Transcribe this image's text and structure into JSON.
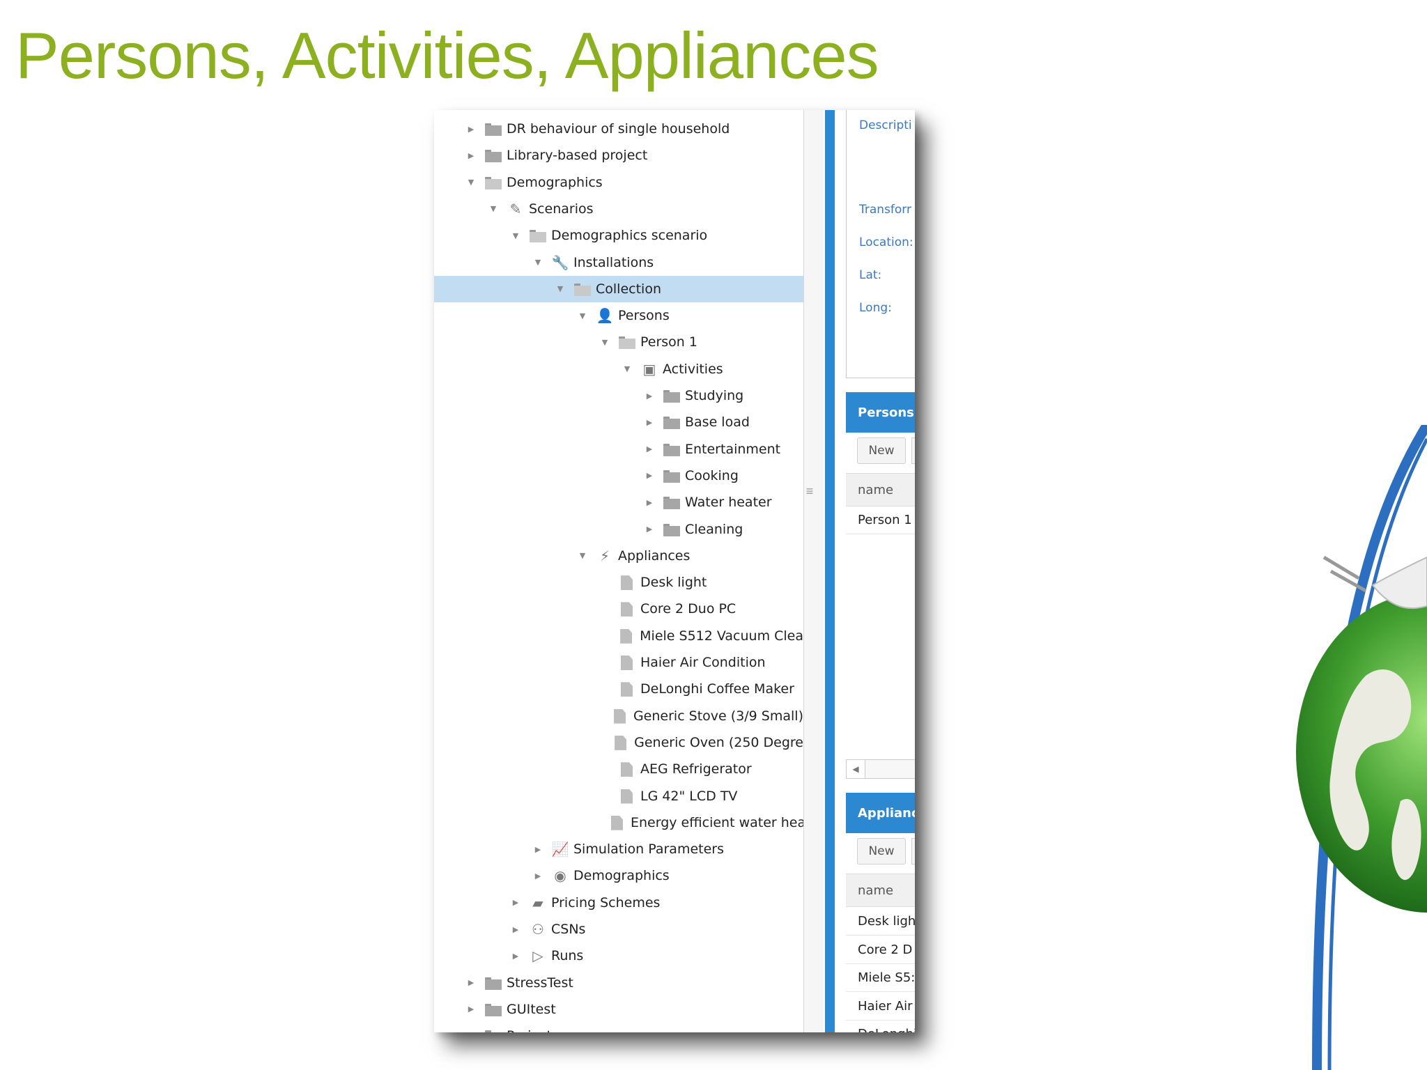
{
  "slide": {
    "title": "Persons, Activities, Appliances"
  },
  "tree": {
    "rows": [
      {
        "label": "DR behaviour of single household",
        "caret": "▶",
        "icon": "folder"
      },
      {
        "label": "Library-based project",
        "caret": "▶",
        "icon": "folder"
      },
      {
        "label": "Demographics",
        "caret": "▼",
        "icon": "folder-open"
      },
      {
        "label": "Scenarios",
        "caret": "▼",
        "icon": "pencil-icon"
      },
      {
        "label": "Demographics scenario",
        "caret": "▼",
        "icon": "folder-open"
      },
      {
        "label": "Installations",
        "caret": "▼",
        "icon": "wrench-icon"
      },
      {
        "label": "Collection",
        "caret": "▼",
        "icon": "folder-open"
      },
      {
        "label": "Persons",
        "caret": "▼",
        "icon": "person-icon"
      },
      {
        "label": "Person 1",
        "caret": "▼",
        "icon": "folder-open"
      },
      {
        "label": "Activities",
        "caret": "▼",
        "icon": "activities-icon"
      },
      {
        "label": "Studying",
        "caret": "▶",
        "icon": "folder"
      },
      {
        "label": "Base load",
        "caret": "▶",
        "icon": "folder"
      },
      {
        "label": "Entertainment",
        "caret": "▶",
        "icon": "folder"
      },
      {
        "label": "Cooking",
        "caret": "▶",
        "icon": "folder"
      },
      {
        "label": "Water heater",
        "caret": "▶",
        "icon": "folder"
      },
      {
        "label": "Cleaning",
        "caret": "▶",
        "icon": "folder"
      },
      {
        "label": "Appliances",
        "caret": "▼",
        "icon": "plug-icon"
      },
      {
        "label": "Desk light",
        "caret": "",
        "icon": "doc"
      },
      {
        "label": "Core 2 Duo PC",
        "caret": "",
        "icon": "doc"
      },
      {
        "label": "Miele S512 Vacuum Clea",
        "caret": "",
        "icon": "doc"
      },
      {
        "label": "Haier Air Condition",
        "caret": "",
        "icon": "doc"
      },
      {
        "label": "DeLonghi Coffee Maker",
        "caret": "",
        "icon": "doc"
      },
      {
        "label": "Generic Stove (3/9 Small)",
        "caret": "",
        "icon": "doc"
      },
      {
        "label": "Generic Oven (250 Degre",
        "caret": "",
        "icon": "doc"
      },
      {
        "label": "AEG Refrigerator",
        "caret": "",
        "icon": "doc"
      },
      {
        "label": "LG 42\" LCD TV",
        "caret": "",
        "icon": "doc"
      },
      {
        "label": "Energy efficient water hea",
        "caret": "",
        "icon": "doc"
      },
      {
        "label": "Simulation Parameters",
        "caret": "▶",
        "icon": "chart-icon"
      },
      {
        "label": "Demographics",
        "caret": "▶",
        "icon": "globe-icon"
      },
      {
        "label": "Pricing Schemes",
        "caret": "▶",
        "icon": "money-icon"
      },
      {
        "label": "CSNs",
        "caret": "▶",
        "icon": "network-icon"
      },
      {
        "label": "Runs",
        "caret": "▶",
        "icon": "play-icon"
      },
      {
        "label": "StressTest",
        "caret": "▶",
        "icon": "folder"
      },
      {
        "label": "GUItest",
        "caret": "▶",
        "icon": "folder"
      },
      {
        "label": "Project",
        "caret": "▶",
        "icon": "folder"
      }
    ]
  },
  "details": {
    "description_label": "Descripti",
    "transform_label": "Transforr",
    "location_label": "Location:",
    "lat_label": "Lat:",
    "long_label": "Long:"
  },
  "persons_panel": {
    "title": "Persons",
    "new_label": "New",
    "column": "name",
    "rows": [
      "Person 1"
    ]
  },
  "appliances_panel": {
    "title": "Applianc",
    "new_label": "New",
    "column": "name",
    "rows": [
      "Desk ligh",
      "Core 2 D",
      "Miele S5:",
      "Haier Air",
      "DeLonghi"
    ]
  },
  "colors": {
    "title_green": "#8db021",
    "accent_blue": "#2c88d0",
    "selection": "#c2dcf2"
  }
}
